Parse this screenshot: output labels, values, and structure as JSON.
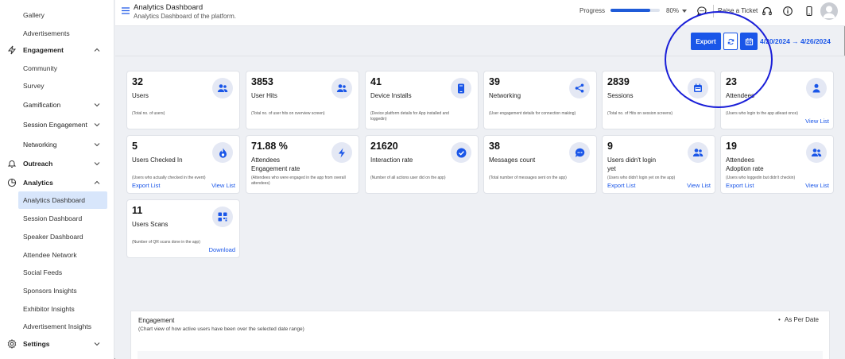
{
  "sidebar": {
    "items": [
      {
        "label": "Gallery"
      },
      {
        "label": "Advertisements"
      },
      {
        "label": "Engagement"
      },
      {
        "label": "Community"
      },
      {
        "label": "Survey"
      },
      {
        "label": "Gamification"
      },
      {
        "label": "Session Engagement"
      },
      {
        "label": "Networking"
      },
      {
        "label": "Outreach"
      },
      {
        "label": "Analytics"
      },
      {
        "label": "Analytics Dashboard"
      },
      {
        "label": "Session Dashboard"
      },
      {
        "label": "Speaker Dashboard"
      },
      {
        "label": "Attendee Network"
      },
      {
        "label": "Social Feeds"
      },
      {
        "label": "Sponsors Insights"
      },
      {
        "label": "Exhibitor Insights"
      },
      {
        "label": "Advertisement Insights"
      },
      {
        "label": "Settings"
      }
    ]
  },
  "header": {
    "title": "Analytics Dashboard",
    "subtitle": "Analytics Dashboard of the platform.",
    "progress_label": "Progress",
    "progress_value": "80%",
    "progress_fraction": 0.8,
    "ticket_label": "Raise a Ticket"
  },
  "toolbar": {
    "export_label": "Export",
    "date_range": "4/20/2024 → 4/26/2024"
  },
  "cards": [
    {
      "value": "32",
      "label": "Users",
      "desc": "(Total no. of users)",
      "icon": "users-icon"
    },
    {
      "value": "3853",
      "label": "User Hits",
      "desc": "(Total no. of user hits on overview screen)",
      "icon": "users-icon"
    },
    {
      "value": "41",
      "label": "Device Installs",
      "desc": "(Device platform details for App installed and loggedin)",
      "icon": "phone-icon"
    },
    {
      "value": "39",
      "label": "Networking",
      "desc": "(User engagement details for connection making)",
      "icon": "share-icon"
    },
    {
      "value": "2839",
      "label": "Sessions",
      "desc": "(Total no. of Hits on session screens)",
      "icon": "calendar-icon"
    },
    {
      "value": "23",
      "label": "Attendees",
      "desc": "(Users who login to the app atleast once)",
      "icon": "user-icon",
      "link_right": "View List"
    },
    {
      "value": "5",
      "label": "Users Checked In",
      "desc": "(Users who actually checked in the event)",
      "icon": "fire-icon",
      "link_left": "Export List",
      "link_right": "View List"
    },
    {
      "value": "71.88 %",
      "label": "Attendees\nEngagement rate",
      "desc": "(Attendees who were engaged in the app from overall attendees)",
      "icon": "bolt-icon"
    },
    {
      "value": "21620",
      "label": "Interaction rate",
      "desc": "(Number of all actions user did on the app)",
      "icon": "check-icon"
    },
    {
      "value": "38",
      "label": "Messages count",
      "desc": "(Total number of messages sent on the app)",
      "icon": "chat-icon"
    },
    {
      "value": "9",
      "label": "Users didn't login\nyet",
      "desc": "(Users who didn't login yet on the app)",
      "icon": "users-icon",
      "link_left": "Export List",
      "link_right": "View List"
    },
    {
      "value": "19",
      "label": "Attendees\nAdoption rate",
      "desc": "(Users who loggedin but didn't checkin)",
      "icon": "users-icon",
      "link_left": "Export List",
      "link_right": "View List"
    },
    {
      "value": "11",
      "label": "Users Scans",
      "desc": "(Number of QR scans done in the app)",
      "icon": "qr-icon",
      "link_right": "Download"
    }
  ],
  "engagement": {
    "title": "Engagement",
    "subtitle": "(Chart view of how active users have been over the selected date range)",
    "legend": "As Per Date"
  },
  "colors": {
    "accent": "#1a56e8",
    "icon_bg": "#e4e8f4",
    "active_nav": "#d8e6fb"
  }
}
